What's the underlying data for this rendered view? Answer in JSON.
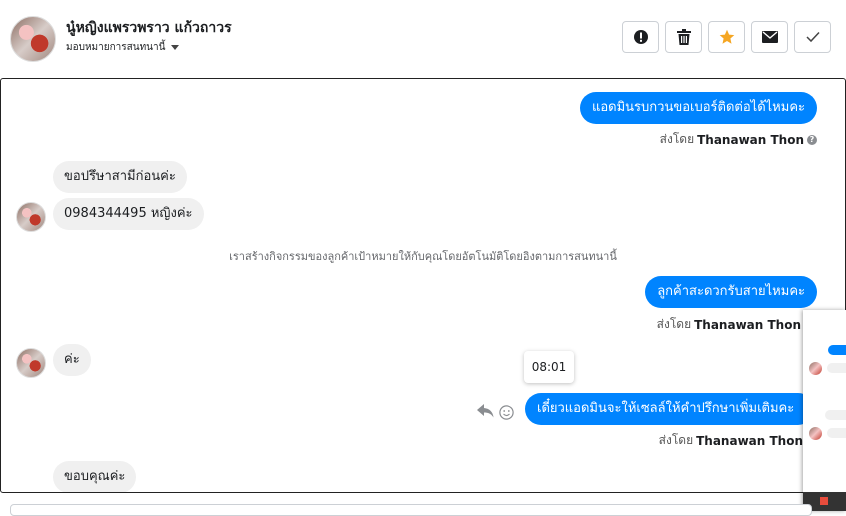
{
  "header": {
    "contact_name": "นู๋หญิงแพรวพราว แก้วถาวร",
    "assign_label": "มอบหมายการสนทนานี้",
    "actions": [
      {
        "name": "spam-button",
        "icon": "alert-circle-icon"
      },
      {
        "name": "delete-button",
        "icon": "trash-icon"
      },
      {
        "name": "star-button",
        "icon": "star-icon"
      },
      {
        "name": "unread-button",
        "icon": "envelope-icon"
      },
      {
        "name": "done-button",
        "icon": "check-icon"
      }
    ]
  },
  "chat": {
    "messages": {
      "out_1": "แอดมินรบกวนขอเบอร์ติดต่อได้ไหมคะ",
      "in_1": "ขอปรึษาสามีก่อนค่ะ",
      "in_2": "0984344495 หญิงค่ะ",
      "system": "เราสร้างกิจกรรมของลูกค้าเป้าหมายให้กับคุณโดยอัตโนมัติโดยอิงตามการสนทนานี้",
      "out_2": "ลูกค้าสะดวกรับสายไหมคะ",
      "in_3": "ค่ะ",
      "out_3": "เดี๋ยวแอดมินจะให้เซลล์ให้คำปรึกษาเพิ่มเติมคะ",
      "in_4": "ขอบคุณค่ะ"
    },
    "sent_by_prefix": "ส่งโดย",
    "sender": "Thanawan Thon",
    "tooltip_time": "08:01"
  },
  "colors": {
    "outgoing_bubble": "#0084ff",
    "incoming_bubble": "#f0f0f0",
    "star": "#f5a623"
  }
}
